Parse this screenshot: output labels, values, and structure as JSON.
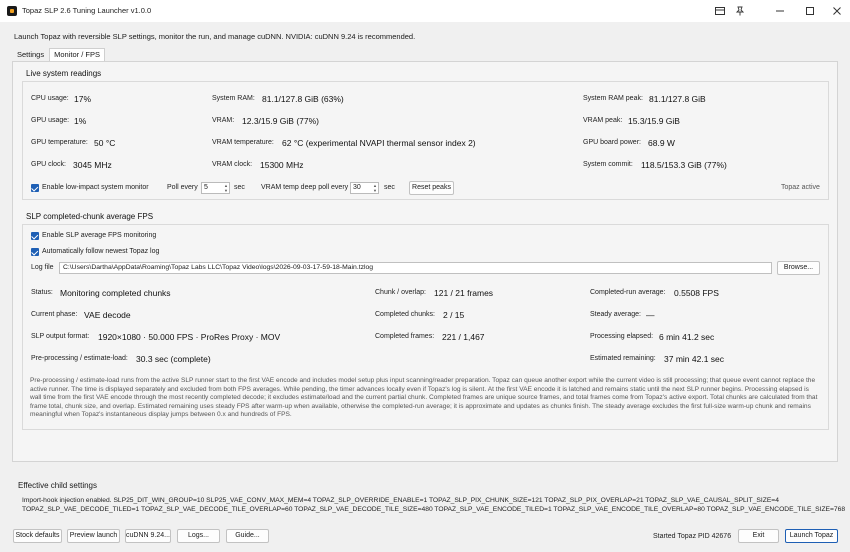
{
  "window": {
    "title": "Topaz SLP 2.6 Tuning Launcher v1.0.0"
  },
  "intro": "Launch Topaz with reversible SLP settings, monitor the run, and manage cuDNN. NVIDIA: cuDNN 9.24 is recommended.",
  "tabs": [
    "Settings",
    "Monitor / FPS"
  ],
  "live": {
    "title": "Live system readings",
    "cpu_label": "CPU usage:",
    "cpu": "17%",
    "gpu_label": "GPU usage:",
    "gpu": "1%",
    "gputemp_label": "GPU temperature:",
    "gputemp": "50 °C",
    "gpuclock_label": "GPU clock:",
    "gpuclock": "3045 MHz",
    "ram_label": "System RAM:",
    "ram": "81.1/127.8 GiB (63%)",
    "vram_label": "VRAM:",
    "vram": "12.3/15.9 GiB (77%)",
    "vramtemp_label": "VRAM temperature:",
    "vramtemp": "62 °C (experimental NVAPI thermal sensor index 2)",
    "vramclock_label": "VRAM clock:",
    "vramclock": "15300 MHz",
    "rampeak_label": "System RAM peak:",
    "rampeak": "81.1/127.8 GiB",
    "vrampeak_label": "VRAM peak:",
    "vrampeak": "15.3/15.9 GiB",
    "boardpower_label": "GPU board power:",
    "boardpower": "68.9 W",
    "commit_label": "System commit:",
    "commit": "118.5/153.3 GiB (77%)",
    "lowimpact_label": "Enable low-impact system monitor",
    "pollevery_label": "Poll every",
    "poll_value": "5",
    "sec1": "sec",
    "vrampoll_label": "VRAM temp deep poll every",
    "vrampoll_value": "30",
    "sec2": "sec",
    "reset_label": "Reset peaks",
    "topaz_status": "Topaz active"
  },
  "slp": {
    "title": "SLP completed-chunk average FPS",
    "enable_label": "Enable SLP average FPS monitoring",
    "follow_label": "Automatically follow newest Topaz log",
    "logfile_label": "Log file",
    "logfile_value": "C:\\Users\\Dartha\\AppData\\Roaming\\Topaz Labs LLC\\Topaz Video\\logs\\2026-09-03-17-59-18-Main.tzlog",
    "browse_label": "Browse...",
    "status_label": "Status:",
    "status": "Monitoring completed chunks",
    "phase_label": "Current phase:",
    "phase": "VAE decode",
    "output_label": "SLP output format:",
    "output": "1920×1080 · 50.000 FPS · ProRes Proxy · MOV",
    "preproc_label": "Pre-processing / estimate-load:",
    "preproc": "30.3 sec (complete)",
    "chunk_label": "Chunk / overlap:",
    "chunk": "121 / 21 frames",
    "completed_chunks_label": "Completed chunks:",
    "completed_chunks": "2 / 15",
    "completed_frames_label": "Completed frames:",
    "completed_frames": "221 / 1,467",
    "runavg_label": "Completed-run average:",
    "runavg": "0.5508 FPS",
    "steady_label": "Steady average:",
    "steady": "—",
    "elapsed_label": "Processing elapsed:",
    "elapsed": "6 min 41.2 sec",
    "remaining_label": "Estimated remaining:",
    "remaining": "37 min 42.1 sec",
    "note": "Pre-processing / estimate-load runs from the active SLP runner start to the first VAE encode and includes model setup plus input scanning/reader preparation. Topaz can queue another export while the current video is still processing; that queue event cannot replace the active runner. The time is displayed separately and excluded from both FPS averages. While pending, the timer advances locally even if Topaz's log is silent. At the first VAE encode it is latched and remains static until the next SLP runner begins. Processing elapsed is wall time from the first VAE encode through the most recently completed decode; it excludes estimate/load and the current partial chunk. Completed frames are unique source frames, and total frames come from Topaz's active export. Total chunks are calculated from that frame total, chunk size, and overlap. Estimated remaining uses steady FPS after warm-up when available, otherwise the completed-run average; it is approximate and updates as chunks finish. The steady average excludes the first full-size warm-up chunk and remains meaningful when Topaz's instantaneous display jumps between 0.x and hundreds of FPS."
  },
  "effective": {
    "title": "Effective child settings",
    "line1": "Import-hook injection enabled. SLP25_DIT_WIN_GROUP=10  SLP25_VAE_CONV_MAX_MEM=4  TOPAZ_SLP_OVERRIDE_ENABLE=1  TOPAZ_SLP_PIX_CHUNK_SIZE=121  TOPAZ_SLP_PIX_OVERLAP=21  TOPAZ_SLP_VAE_CAUSAL_SPLIT_SIZE=4",
    "line2": "TOPAZ_SLP_VAE_DECODE_TILED=1  TOPAZ_SLP_VAE_DECODE_TILE_OVERLAP=60  TOPAZ_SLP_VAE_DECODE_TILE_SIZE=480  TOPAZ_SLP_VAE_ENCODE_TILED=1  TOPAZ_SLP_VAE_ENCODE_TILE_OVERLAP=80  TOPAZ_SLP_VAE_ENCODE_TILE_SIZE=768"
  },
  "footer": {
    "stock": "Stock defaults",
    "preview": "Preview launch",
    "cudnn": "cuDNN 9.24...",
    "logs": "Logs...",
    "guide": "Guide...",
    "started": "Started Topaz PID 42676",
    "exit": "Exit",
    "launch": "Launch Topaz"
  },
  "icons": [
    "app-icon",
    "snap-icon",
    "pin-icon",
    "minimize-icon",
    "maximize-icon",
    "close-icon"
  ]
}
